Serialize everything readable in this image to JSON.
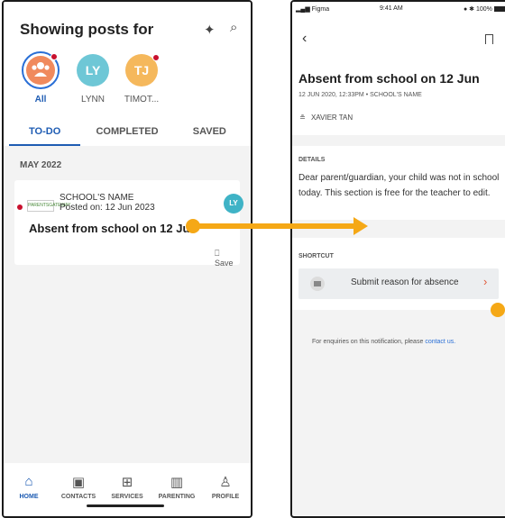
{
  "feed": {
    "title": "Showing posts for",
    "sparkle_glyph": "✦",
    "search_glyph": "⌕",
    "avatars": [
      {
        "label": "All",
        "initials": "",
        "color": "#f08a5d"
      },
      {
        "label": "LYNN",
        "initials": "LY",
        "color": "#6ec7d6"
      },
      {
        "label": "TIMOT...",
        "initials": "TJ",
        "color": "#f5b85c"
      }
    ],
    "tabs": [
      "TO-DO",
      "COMPLETED",
      "SAVED"
    ],
    "month": "MAY 2022",
    "post": {
      "logo_text": "PARENTSGATEWAY",
      "school": "SCHOOL'S NAME",
      "posted": "Posted on: 12 Jun 2023",
      "avatar_initials": "LY",
      "headline": "Absent from school on 12 Jun",
      "save_label": "Save",
      "save_glyph": "⎕"
    },
    "nav": [
      {
        "label": "HOME",
        "icon": "⌂"
      },
      {
        "label": "CONTACTS",
        "icon": "▣"
      },
      {
        "label": "SERVICES",
        "icon": "⊞"
      },
      {
        "label": "PARENTING",
        "icon": "▥"
      },
      {
        "label": "PROFILE",
        "icon": "♙"
      }
    ]
  },
  "detail": {
    "status": {
      "carrier": "Figma",
      "time": "9:41 AM",
      "battery": "100%"
    },
    "back_glyph": "‹",
    "title": "Absent from school on 12 Jun",
    "meta": "12 JUN 2020, 12:33PM  •  SCHOOL'S NAME",
    "author": "XAVIER TAN",
    "author_glyph": "≗",
    "details_label": "DETAILS",
    "details_body": "Dear parent/guardian, your child was not in school today. This section is free for the teacher to edit.",
    "shortcut_label": "SHORTCUT",
    "shortcut_button": "Submit reason for absence",
    "chevron_glyph": "›",
    "enquiry_text": "For enquiries on this notification, please",
    "enquiry_link": "contact us."
  },
  "colors": {
    "accent": "#1e5cb3",
    "arrow": "#f5a816",
    "alert": "#c8102e"
  }
}
